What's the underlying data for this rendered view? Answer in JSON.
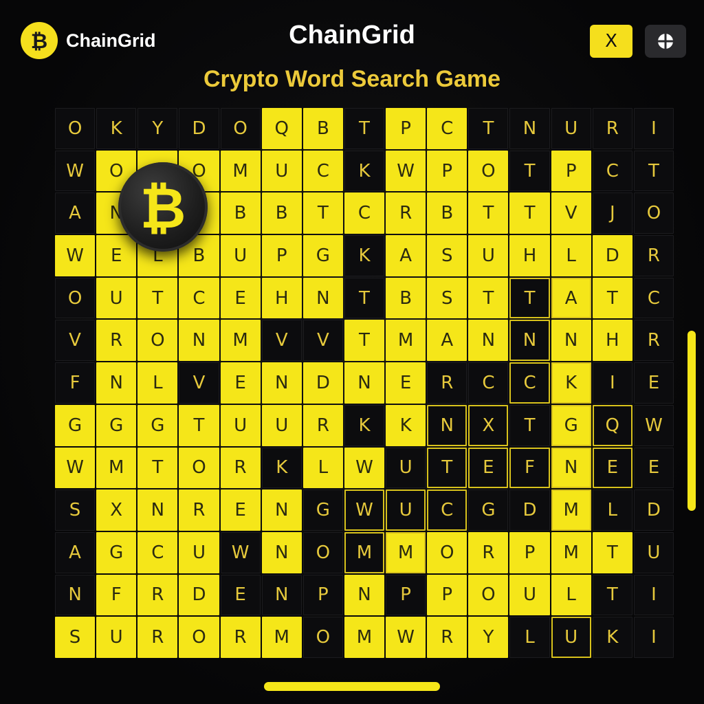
{
  "brand": {
    "name": "ChainGrid",
    "logo_icon": "bitcoin-icon"
  },
  "header": {
    "title": "ChainGrid",
    "close_label": "X",
    "settings_icon": "crosshair-icon"
  },
  "subtitle": "Crypto Word Search Game",
  "colors": {
    "accent": "#f5e619",
    "dark_cell": "#0c0c0e",
    "subtitle": "#ecca3a",
    "dark_letter": "#e6c93c"
  },
  "grid": {
    "rows": [
      "OKYDOQBTPCTNURI",
      "WOOOMUCKWPOTPCT",
      "ANNBBBTCRBTTVJO",
      "WELBUPGKASUHLDR",
      "OUTCEHNTBSTTATC",
      "VRONMVVTMANNNHR",
      "FNLVENDNERCCKIE",
      "GGGTUURKKNXTGQW",
      "WMTORKLWUTEFNEE",
      "SXNRENGWUCGDMLD",
      "AGCUWNOMMORPMTU",
      "NFRDENPNPPOULTI",
      "SURORMOMWRYLUKI"
    ],
    "fill": [
      "DDDDDYYDYYDDDDD",
      "DYYYYYYDYYYDYDD",
      "DYYYYYYYYYYYYDD",
      "YYYYYYYDYYYYYYD",
      "DYYYYYYDYYYDYYD",
      "DYYYYDDYYYYDYYD",
      "DYYDYYYYYDDDYDD",
      "YYYYYYYDYDDDYDD",
      "YYYYYDYYDDDDYDD",
      "DYYYYYDDDDDDYDD",
      "DYYYDYDDYYYYYYD",
      "DYYYDDDYDYYYYDD",
      "YYYYYYDYYYYDDDD"
    ],
    "outlined": [
      [
        4,
        11
      ],
      [
        4,
        12
      ],
      [
        5,
        11
      ],
      [
        6,
        11
      ],
      [
        6,
        12
      ],
      [
        7,
        9
      ],
      [
        7,
        10
      ],
      [
        7,
        12
      ],
      [
        7,
        13
      ],
      [
        8,
        9
      ],
      [
        8,
        10
      ],
      [
        8,
        11
      ],
      [
        8,
        12
      ],
      [
        8,
        13
      ],
      [
        9,
        7
      ],
      [
        9,
        8
      ],
      [
        9,
        9
      ],
      [
        9,
        12
      ],
      [
        10,
        7
      ],
      [
        10,
        8
      ],
      [
        12,
        12
      ]
    ]
  }
}
